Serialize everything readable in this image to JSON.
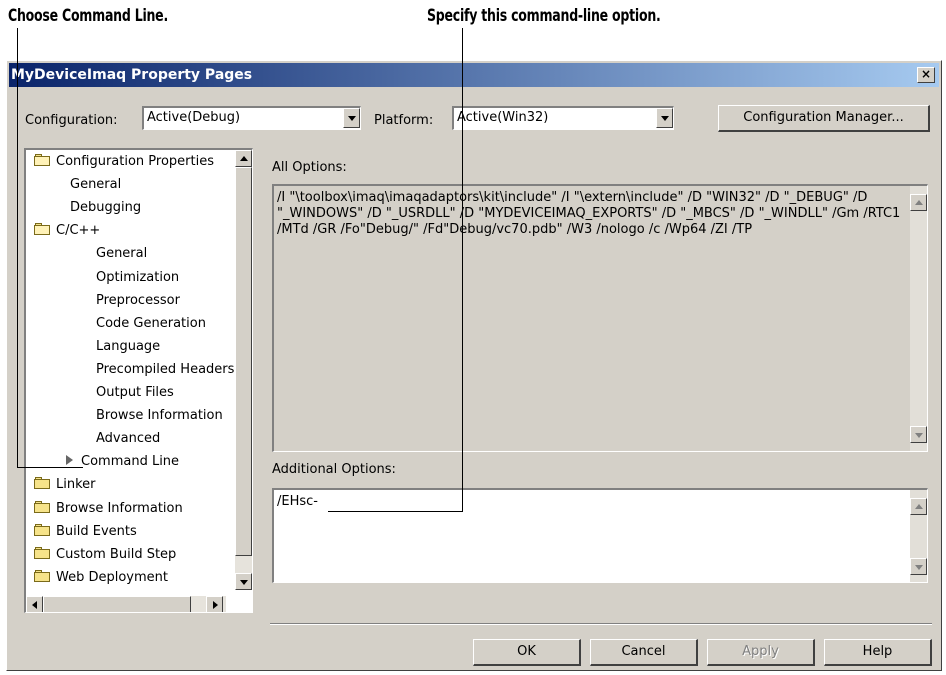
{
  "callouts": {
    "left": "Choose Command Line.",
    "right": "Specify this command-line option."
  },
  "dialog": {
    "title": "MyDeviceImaq Property Pages",
    "close_label": "×"
  },
  "configuration": {
    "label": "Configuration:",
    "value": "Active(Debug)"
  },
  "platform": {
    "label": "Platform:",
    "value": "Active(Win32)"
  },
  "config_manager_label": "Configuration Manager...",
  "tree": {
    "items": [
      {
        "label": "Configuration Properties",
        "type": "folder-open"
      },
      {
        "label": "General",
        "type": "text"
      },
      {
        "label": "Debugging",
        "type": "text"
      },
      {
        "label": "C/C++",
        "type": "folder-open"
      },
      {
        "label": "General",
        "type": "text"
      },
      {
        "label": "Optimization",
        "type": "text"
      },
      {
        "label": "Preprocessor",
        "type": "text"
      },
      {
        "label": "Code Generation",
        "type": "text"
      },
      {
        "label": "Language",
        "type": "text"
      },
      {
        "label": "Precompiled Headers",
        "type": "text"
      },
      {
        "label": "Output Files",
        "type": "text"
      },
      {
        "label": "Browse Information",
        "type": "text"
      },
      {
        "label": "Advanced",
        "type": "text"
      },
      {
        "label": "Command Line",
        "type": "selected"
      },
      {
        "label": "Linker",
        "type": "folder"
      },
      {
        "label": "Browse Information",
        "type": "folder"
      },
      {
        "label": "Build Events",
        "type": "folder"
      },
      {
        "label": "Custom Build Step",
        "type": "folder"
      },
      {
        "label": "Web Deployment",
        "type": "folder"
      }
    ]
  },
  "all_options": {
    "label": "All Options:",
    "text": "/I \"\\toolbox\\imaq\\imaqadaptors\\kit\\include\" /I \"\\extern\\include\" /D \"WIN32\" /D \"_DEBUG\" /D \"_WINDOWS\" /D \"_USRDLL\" /D \"MYDEVICEIMAQ_EXPORTS\" /D \"_MBCS\" /D \"_WINDLL\" /Gm /RTC1 /MTd /GR /Fo\"Debug/\" /Fd\"Debug/vc70.pdb\" /W3 /nologo /c /Wp64 /ZI /TP"
  },
  "additional_options": {
    "label": "Additional Options:",
    "text": "/EHsc-"
  },
  "buttons": {
    "ok": "OK",
    "cancel": "Cancel",
    "apply": "Apply",
    "help": "Help"
  }
}
